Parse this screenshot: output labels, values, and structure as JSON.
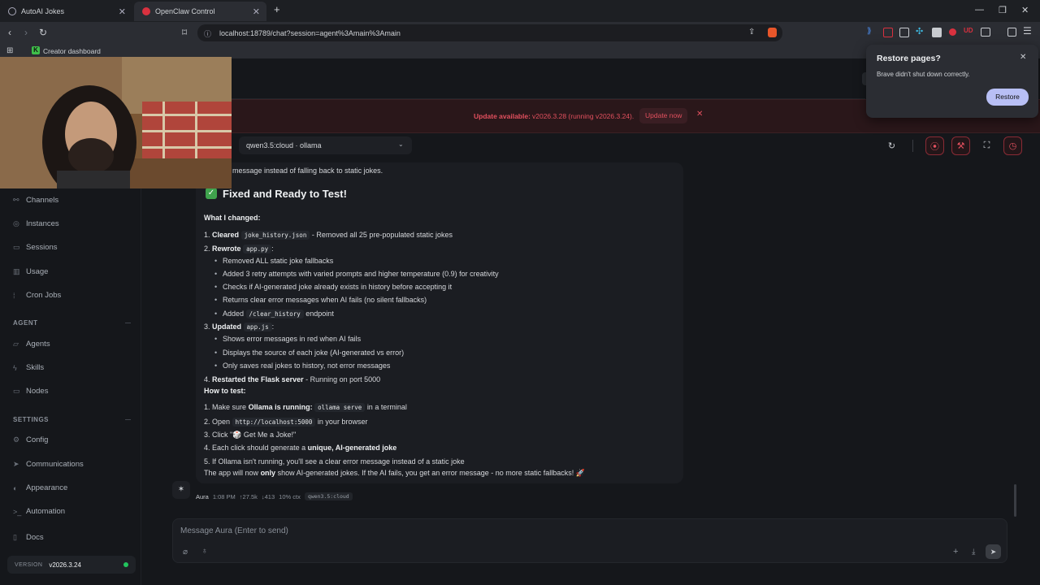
{
  "browser": {
    "tabs": [
      {
        "title": "AutoAI Jokes"
      },
      {
        "title": "OpenClaw Control"
      }
    ],
    "url": "localhost:18789/chat?session=agent%3Amain%3Amain",
    "bookmark": "Creator dashboard"
  },
  "banner": {
    "label": "Update available:",
    "text": "v2026.3.28 (running v2026.3.24).",
    "action": "Update now"
  },
  "restore_popup": {
    "title": "Restore pages?",
    "body": "Brave didn't shut down correctly.",
    "button": "Restore"
  },
  "model_select": "qwen3.5:cloud · ollama",
  "sidebar": {
    "items_top": [
      "Channels",
      "Instances",
      "Sessions",
      "Usage",
      "Cron Jobs"
    ],
    "agent_head": "AGENT",
    "agent_items": [
      "Agents",
      "Skills",
      "Nodes"
    ],
    "settings_head": "SETTINGS",
    "settings_items": [
      "Config",
      "Communications",
      "Appearance",
      "Automation"
    ],
    "docs": "Docs",
    "version_label": "VERSION",
    "version_value": "v2026.3.24"
  },
  "message": {
    "cut_line": "message instead of falling back to static jokes.",
    "heading": "Fixed and Ready to Test!",
    "what_changed": "What I changed:",
    "c1_bold": "Cleared",
    "c1_code": "joke_history.json",
    "c1_rest": "- Removed all 25 pre-populated static jokes",
    "c2_bold": "Rewrote",
    "c2_code": "app.py",
    "c2_colon": ":",
    "c2_b1": "Removed ALL static joke fallbacks",
    "c2_b2": "Added 3 retry attempts with varied prompts and higher temperature (0.9) for creativity",
    "c2_b3": "Checks if AI-generated joke already exists in history before accepting it",
    "c2_b4": "Returns clear error messages when AI fails (no silent fallbacks)",
    "c2_b5_pre": "Added",
    "c2_b5_code": "/clear_history",
    "c2_b5_post": "endpoint",
    "c3_bold": "Updated",
    "c3_code": "app.js",
    "c3_colon": ":",
    "c3_b1": "Shows error messages in red when AI fails",
    "c3_b2": "Displays the source of each joke (AI-generated vs error)",
    "c3_b3": "Only saves real jokes to history, not error messages",
    "c4_bold": "Restarted the Flask server",
    "c4_rest": "- Running on port 5000",
    "how_to_test": "How to test:",
    "h1_pre": "Make sure",
    "h1_bold": "Ollama is running:",
    "h1_code": "ollama serve",
    "h1_post": "in a terminal",
    "h2_pre": "Open",
    "h2_code": "http://localhost:5000",
    "h2_post": "in your browser",
    "h3": "Click \"🎲 Get Me a Joke!\"",
    "h4_pre": "Each click should generate a",
    "h4_bold": "unique, AI-generated joke",
    "h5": "If Ollama isn't running, you'll see a clear error message instead of a static joke",
    "final_pre": "The app will now",
    "final_bold": "only",
    "final_post": "show AI-generated jokes. If the AI fails, you get an error message - no more static fallbacks! 🚀",
    "n1": "1.",
    "n2": "2.",
    "n3": "3.",
    "n4": "4.",
    "n5": "5."
  },
  "meta": {
    "author": "Aura",
    "time": "1:08 PM",
    "tokens_in": "↑27.5k",
    "tokens_out": "↓413",
    "ctx": "10% ctx",
    "model": "qwen3.5:cloud"
  },
  "composer": {
    "placeholder": "Message Aura (Enter to send)"
  }
}
